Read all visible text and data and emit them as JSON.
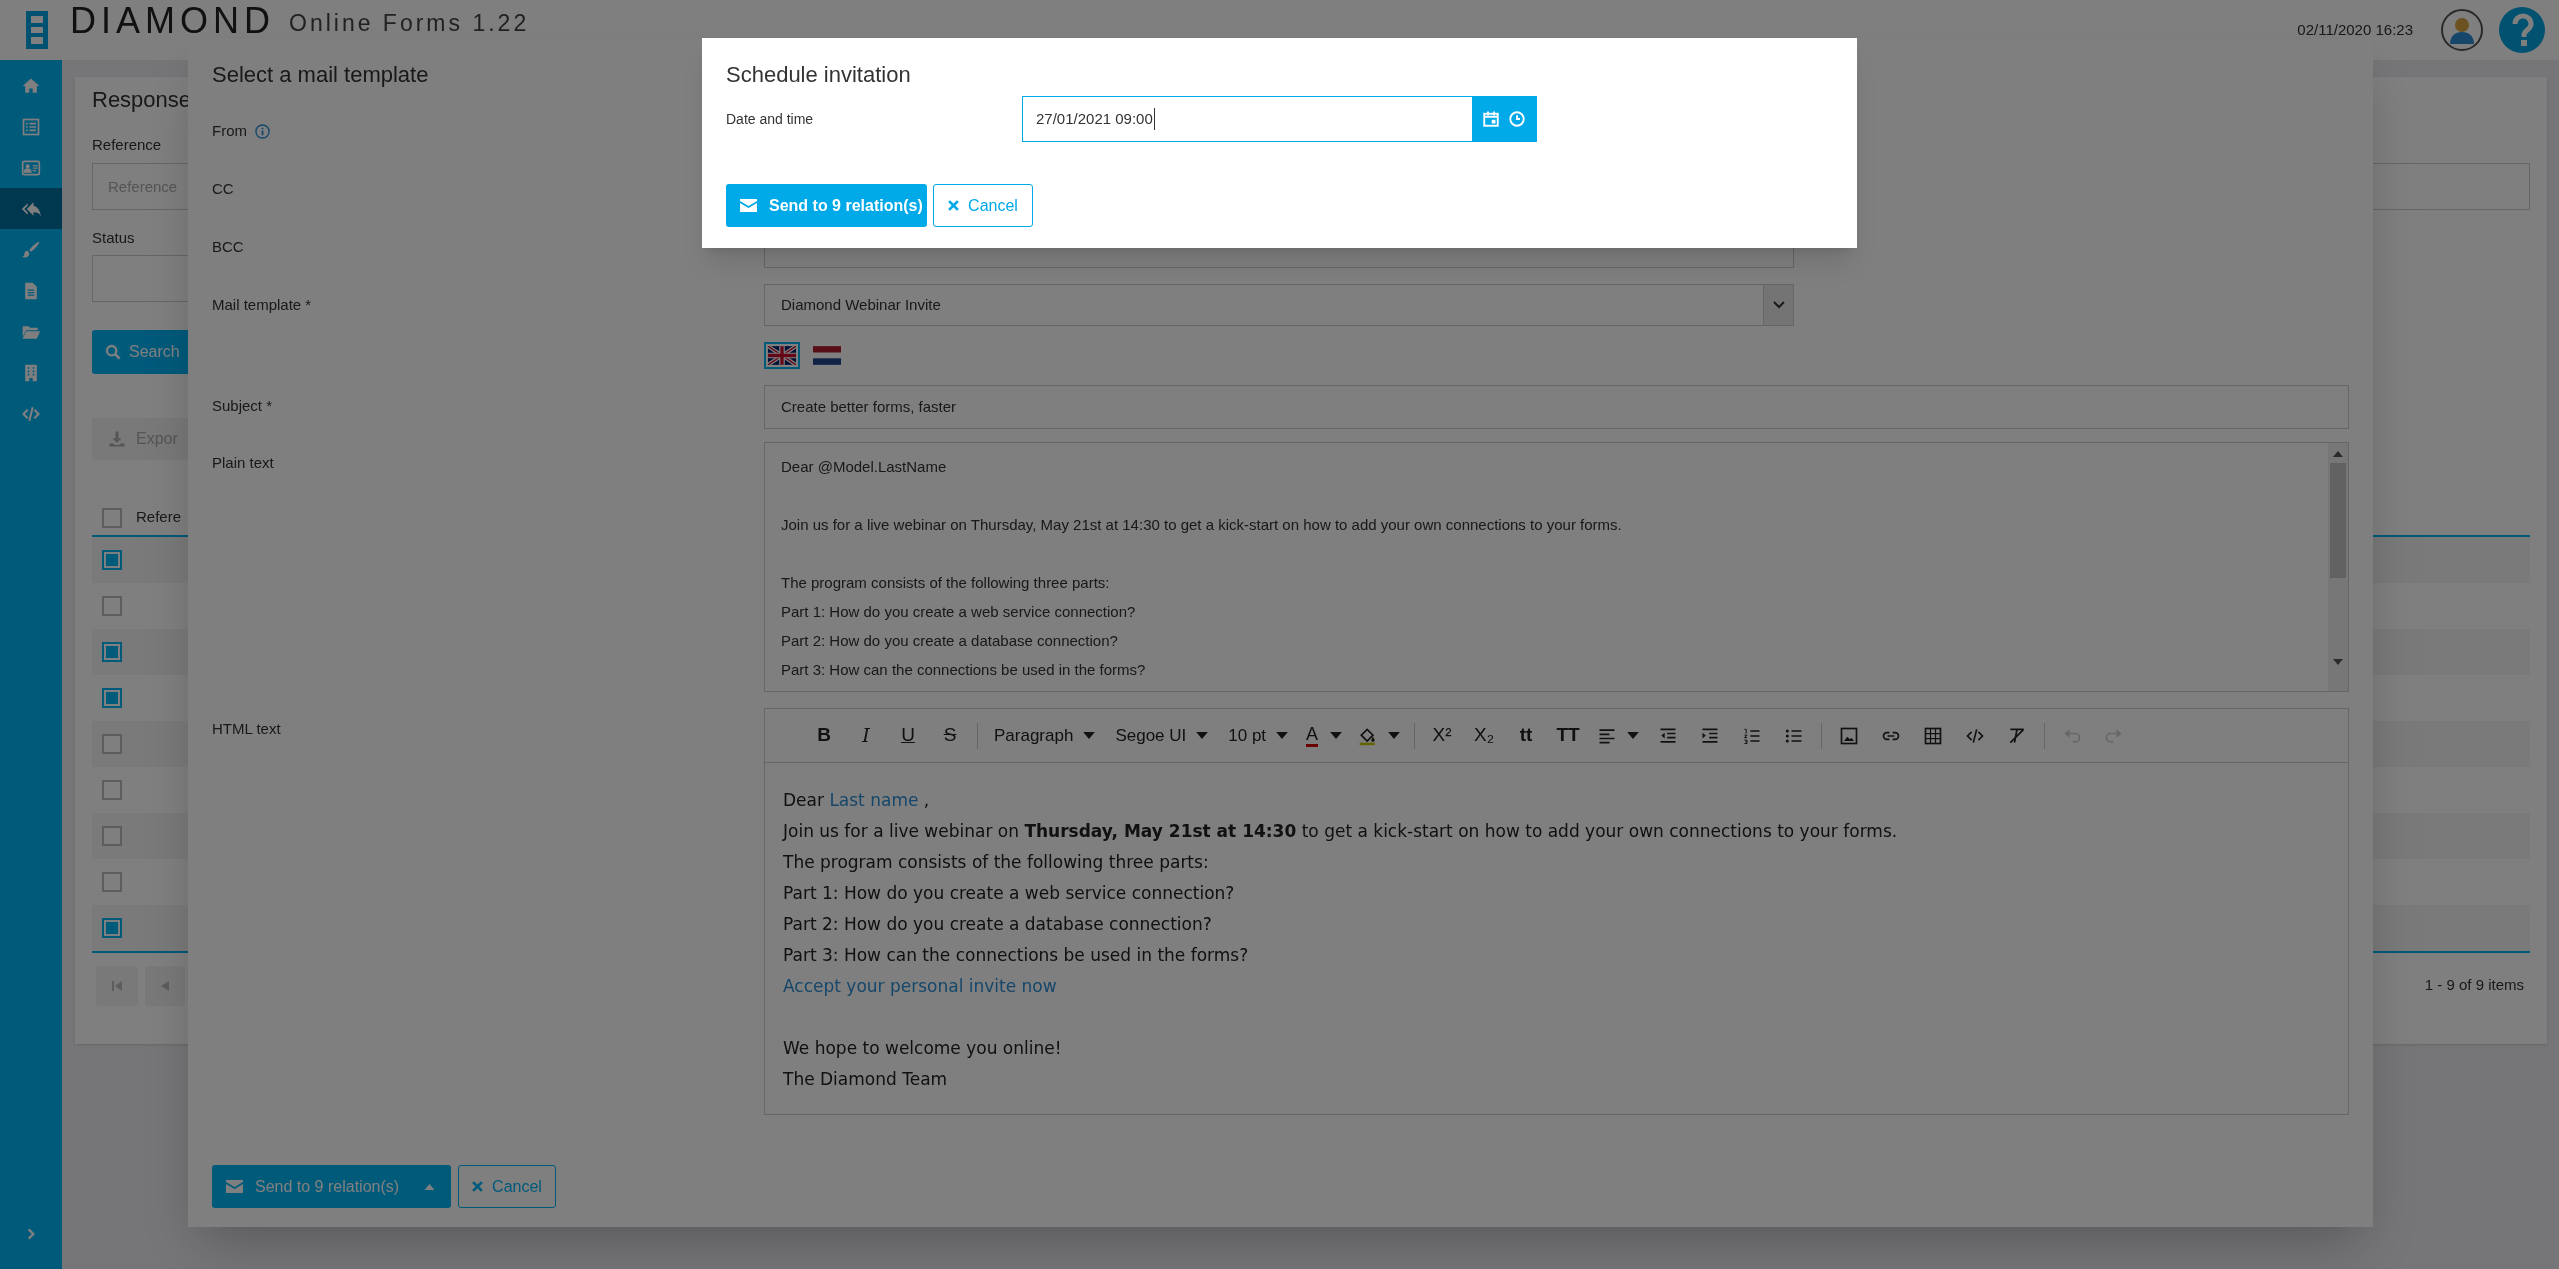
{
  "header": {
    "brand": "DIAMOND",
    "product": "Online Forms",
    "version": "1.22",
    "datetime": "02/11/2020 16:23"
  },
  "sidebar": {
    "items": [
      {
        "kind": "home",
        "selected": false
      },
      {
        "kind": "list",
        "selected": false
      },
      {
        "kind": "card",
        "selected": false
      },
      {
        "kind": "reply",
        "selected": true
      },
      {
        "kind": "brush",
        "selected": false
      },
      {
        "kind": "file",
        "selected": false
      },
      {
        "kind": "folder",
        "selected": false
      },
      {
        "kind": "building",
        "selected": false
      },
      {
        "kind": "code",
        "selected": false
      }
    ]
  },
  "panel": {
    "title": "Response",
    "reference_label": "Reference",
    "reference_placeholder": "Reference",
    "status_label": "Status",
    "search_button": "Search",
    "export_button": "Expor",
    "table": {
      "column": "Refere",
      "all_checked": false,
      "rows": [
        {
          "checked": true
        },
        {
          "checked": false
        },
        {
          "checked": true
        },
        {
          "checked": true
        },
        {
          "checked": false
        },
        {
          "checked": false
        },
        {
          "checked": false
        },
        {
          "checked": false
        },
        {
          "checked": true
        }
      ]
    },
    "pager": "1 - 9 of 9 items"
  },
  "mail_dialog": {
    "title": "Select a mail template",
    "from": {
      "label": "From"
    },
    "cc": {
      "label": "CC"
    },
    "bcc": {
      "label": "BCC"
    },
    "template": {
      "label": "Mail template *",
      "value": "Diamond Webinar Invite"
    },
    "languages": [
      {
        "kind": "en",
        "selected": true
      },
      {
        "kind": "nl",
        "selected": false
      }
    ],
    "subject": {
      "label": "Subject *",
      "value": "Create better forms, faster"
    },
    "plain_text": {
      "label": "Plain text",
      "paragraphs": [
        [
          "Dear @Model.LastName"
        ],
        [
          "Join us for a live webinar on Thursday, May 21st at 14:30 to get a kick-start on how to add your own connections to your forms."
        ],
        [
          "The program consists of the following three parts:",
          "Part 1: How do you create a web service connection?",
          "Part 2: How do you create a database connection?",
          "Part 3: How can the connections be used in the forms?"
        ]
      ]
    },
    "html_text": {
      "label": "HTML text",
      "toolbar": [
        {
          "disabled": false,
          "items": [
            {
              "kind": "bold",
              "glyph": "B"
            },
            {
              "kind": "italic",
              "glyph": "I"
            },
            {
              "kind": "underline",
              "glyph": "U"
            },
            {
              "kind": "strike",
              "glyph": "S"
            }
          ]
        },
        {
          "disabled": false,
          "items": [
            {
              "kind": "dropdown",
              "label": "Paragraph"
            },
            {
              "kind": "dropdown",
              "label": "Segoe UI"
            },
            {
              "kind": "dropdown",
              "label": "10 pt"
            },
            {
              "kind": "font-color",
              "glyph": "A"
            },
            {
              "kind": "fill-color"
            }
          ]
        },
        {
          "disabled": false,
          "items": [
            {
              "kind": "superscript",
              "glyph": "X²"
            },
            {
              "kind": "subscript",
              "glyph": "X₂"
            },
            {
              "kind": "lowercase",
              "glyph": "tt"
            },
            {
              "kind": "uppercase",
              "glyph": "TT"
            },
            {
              "kind": "align"
            },
            {
              "kind": "outdent"
            },
            {
              "kind": "indent"
            },
            {
              "kind": "ordered-list"
            },
            {
              "kind": "bullet-list"
            }
          ]
        },
        {
          "disabled": false,
          "items": [
            {
              "kind": "image"
            },
            {
              "kind": "link"
            },
            {
              "kind": "table"
            },
            {
              "kind": "code"
            },
            {
              "kind": "clear-format"
            }
          ]
        },
        {
          "disabled": true,
          "items": [
            {
              "kind": "undo"
            },
            {
              "kind": "redo"
            }
          ]
        }
      ],
      "paragraphs": [
        [
          {
            "kind": "greeting",
            "text": "Dear ",
            "link": "Last name",
            "tail": " ,"
          },
          {
            "kind": "text",
            "text": "Join us for a live webinar on **Thursday, May 21st at 14:30** to get a kick-start on how to add your own connections to your forms."
          },
          {
            "kind": "text",
            "text": "The program consists of the following three parts:"
          },
          {
            "kind": "text",
            "text": "Part 1: How do you create a web service connection?"
          },
          {
            "kind": "text",
            "text": "Part 2: How do you create a database connection?"
          },
          {
            "kind": "text",
            "text": "Part 3: How can the connections be used in the forms?"
          },
          {
            "kind": "link",
            "text": "Accept your personal invite now"
          }
        ],
        [
          {
            "kind": "text",
            "text": "We hope to welcome you online!"
          },
          {
            "kind": "text",
            "text": "The Diamond Team"
          }
        ]
      ]
    },
    "send_button": "Send to 9 relation(s)",
    "cancel_button": "Cancel"
  },
  "schedule_dialog": {
    "title": "Schedule invitation",
    "date_label": "Date and time",
    "date_value": "27/01/2021 09:00",
    "send_button": "Send to 9 relation(s)",
    "cancel_button": "Cancel"
  }
}
